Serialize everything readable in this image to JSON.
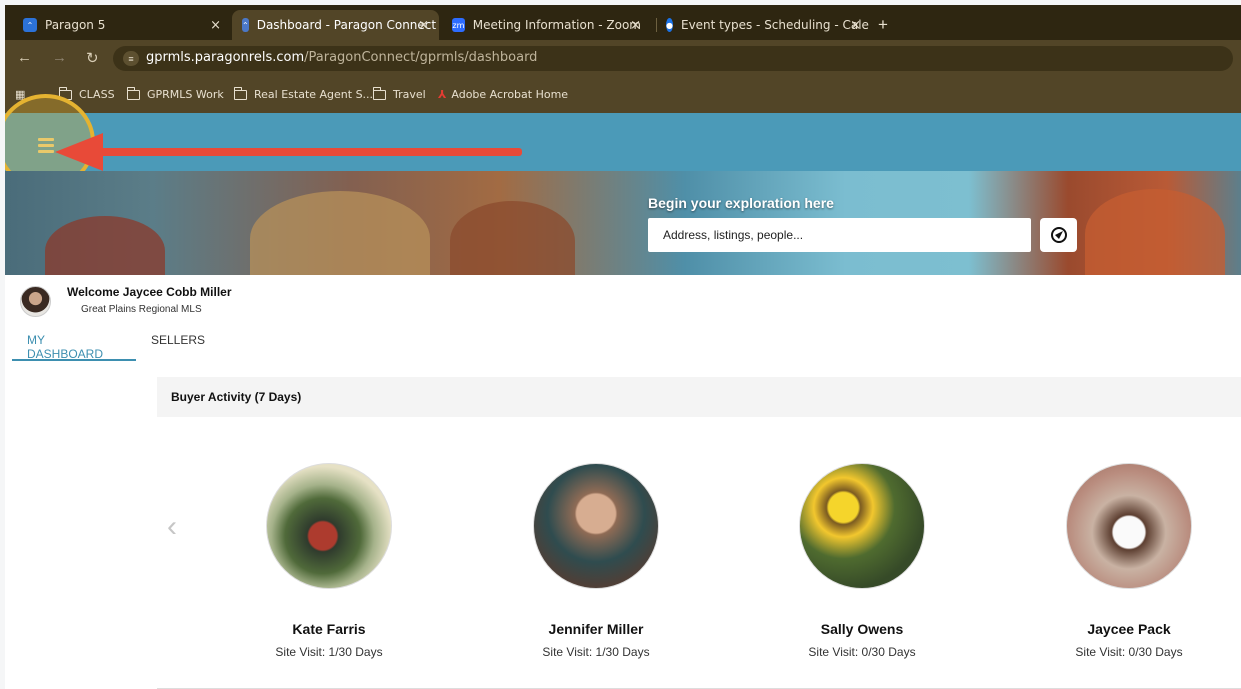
{
  "browser": {
    "tabs": [
      {
        "title": "Paragon 5",
        "color": "#2c72d8",
        "active": false
      },
      {
        "title": "Dashboard - Paragon Connect",
        "color": "#4b78c7",
        "active": true
      },
      {
        "title": "Meeting Information - Zoom",
        "color": "#2d6cff",
        "active": false
      },
      {
        "title": "Event types - Scheduling - Cale",
        "color": "#1a73e8",
        "active": false
      }
    ],
    "url_domain": "gprmls.paragonrels.com",
    "url_path": "/ParagonConnect/gprmls/dashboard",
    "bookmarks": [
      "CLASS",
      "GPRMLS Work",
      "Real Estate Agent S...",
      "Travel",
      "Adobe Acrobat Home"
    ]
  },
  "app": {
    "header_color": "#4b9ab8",
    "hero_label": "Begin your exploration here",
    "search_placeholder": "Address, listings, people...",
    "welcome": "Welcome Jaycee Cobb Miller",
    "org": "Great Plains Regional MLS",
    "tabs": [
      "MY DASHBOARD",
      "SELLERS"
    ],
    "panel_title": "Buyer Activity (7 Days)",
    "buyers": [
      {
        "name": "Kate Farris",
        "visit": "Site Visit: 1/30 Days"
      },
      {
        "name": "Jennifer Miller",
        "visit": "Site Visit: 1/30 Days"
      },
      {
        "name": "Sally Owens",
        "visit": "Site Visit: 0/30 Days"
      },
      {
        "name": "Jaycee Pack",
        "visit": "Site Visit: 0/30 Days"
      }
    ]
  }
}
